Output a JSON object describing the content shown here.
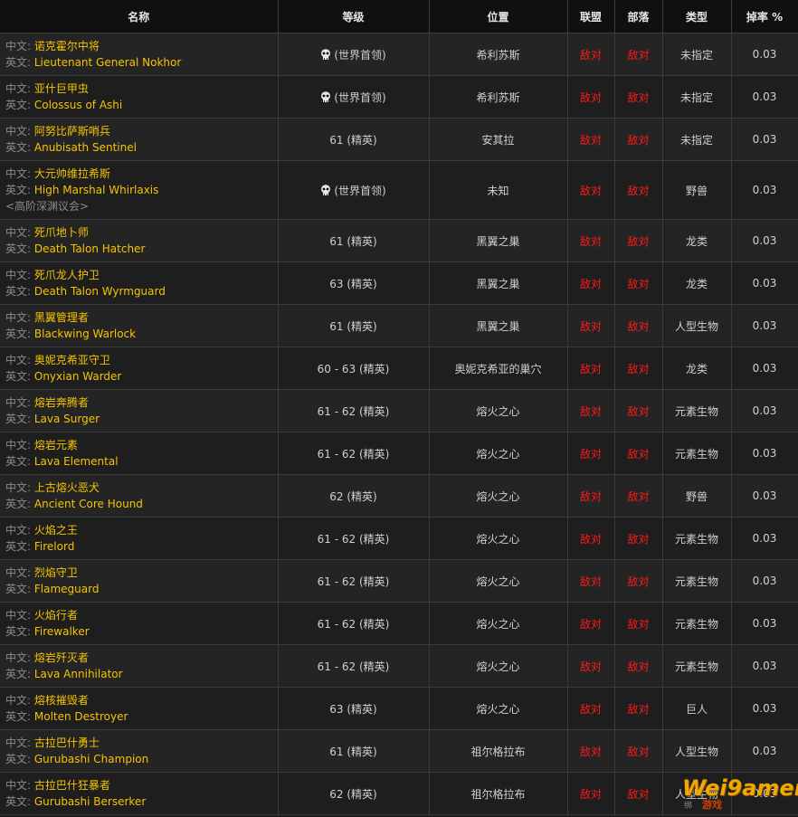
{
  "header": {
    "name": "名称",
    "level": "等级",
    "location": "位置",
    "alliance": "联盟",
    "horde": "部落",
    "type": "类型",
    "drop_rate": "掉率 %"
  },
  "labels": {
    "cn": "中文:",
    "en": "英文:"
  },
  "rows": [
    {
      "cn": "诺克霍尔中将",
      "en": "Lieutenant General Nokhor",
      "sub": "",
      "level": "(世界首领)",
      "skull": true,
      "location": "希利苏斯",
      "alliance": "敌对",
      "horde": "敌对",
      "type": "未指定",
      "rate": "0.03"
    },
    {
      "cn": "亚什巨甲虫",
      "en": "Colossus of Ashi",
      "sub": "",
      "level": "(世界首领)",
      "skull": true,
      "location": "希利苏斯",
      "alliance": "敌对",
      "horde": "敌对",
      "type": "未指定",
      "rate": "0.03"
    },
    {
      "cn": "阿努比萨斯哨兵",
      "en": "Anubisath Sentinel",
      "sub": "",
      "level": "61 (精英)",
      "skull": false,
      "location": "安其拉",
      "alliance": "敌对",
      "horde": "敌对",
      "type": "未指定",
      "rate": "0.03"
    },
    {
      "cn": "大元帅维拉希斯",
      "en": "High Marshal Whirlaxis",
      "sub": "<高阶深渊议会>",
      "level": "(世界首领)",
      "skull": true,
      "location": "未知",
      "alliance": "敌对",
      "horde": "敌对",
      "type": "野兽",
      "rate": "0.03"
    },
    {
      "cn": "死爪地卜师",
      "en": "Death Talon Hatcher",
      "sub": "",
      "level": "61 (精英)",
      "skull": false,
      "location": "黑翼之巢",
      "alliance": "敌对",
      "horde": "敌对",
      "type": "龙类",
      "rate": "0.03"
    },
    {
      "cn": "死爪龙人护卫",
      "en": "Death Talon Wyrmguard",
      "sub": "",
      "level": "63 (精英)",
      "skull": false,
      "location": "黑翼之巢",
      "alliance": "敌对",
      "horde": "敌对",
      "type": "龙类",
      "rate": "0.03"
    },
    {
      "cn": "黑翼管理者",
      "en": "Blackwing Warlock",
      "sub": "",
      "level": "61 (精英)",
      "skull": false,
      "location": "黑翼之巢",
      "alliance": "敌对",
      "horde": "敌对",
      "type": "人型生物",
      "rate": "0.03"
    },
    {
      "cn": "奥妮克希亚守卫",
      "en": "Onyxian Warder",
      "sub": "",
      "level": "60 - 63 (精英)",
      "skull": false,
      "location": "奥妮克希亚的巢穴",
      "alliance": "敌对",
      "horde": "敌对",
      "type": "龙类",
      "rate": "0.03"
    },
    {
      "cn": "熔岩奔腾者",
      "en": "Lava Surger",
      "sub": "",
      "level": "61 - 62 (精英)",
      "skull": false,
      "location": "熔火之心",
      "alliance": "敌对",
      "horde": "敌对",
      "type": "元素生物",
      "rate": "0.03"
    },
    {
      "cn": "熔岩元素",
      "en": "Lava Elemental",
      "sub": "",
      "level": "61 - 62 (精英)",
      "skull": false,
      "location": "熔火之心",
      "alliance": "敌对",
      "horde": "敌对",
      "type": "元素生物",
      "rate": "0.03"
    },
    {
      "cn": "上古熔火恶犬",
      "en": "Ancient Core Hound",
      "sub": "",
      "level": "62 (精英)",
      "skull": false,
      "location": "熔火之心",
      "alliance": "敌对",
      "horde": "敌对",
      "type": "野兽",
      "rate": "0.03"
    },
    {
      "cn": "火焰之王",
      "en": "Firelord",
      "sub": "",
      "level": "61 - 62 (精英)",
      "skull": false,
      "location": "熔火之心",
      "alliance": "敌对",
      "horde": "敌对",
      "type": "元素生物",
      "rate": "0.03"
    },
    {
      "cn": "烈焰守卫",
      "en": "Flameguard",
      "sub": "",
      "level": "61 - 62 (精英)",
      "skull": false,
      "location": "熔火之心",
      "alliance": "敌对",
      "horde": "敌对",
      "type": "元素生物",
      "rate": "0.03"
    },
    {
      "cn": "火焰行者",
      "en": "Firewalker",
      "sub": "",
      "level": "61 - 62 (精英)",
      "skull": false,
      "location": "熔火之心",
      "alliance": "敌对",
      "horde": "敌对",
      "type": "元素生物",
      "rate": "0.03"
    },
    {
      "cn": "熔岩歼灭者",
      "en": "Lava Annihilator",
      "sub": "",
      "level": "61 - 62 (精英)",
      "skull": false,
      "location": "熔火之心",
      "alliance": "敌对",
      "horde": "敌对",
      "type": "元素生物",
      "rate": "0.03"
    },
    {
      "cn": "熔核摧毁者",
      "en": "Molten Destroyer",
      "sub": "",
      "level": "63 (精英)",
      "skull": false,
      "location": "熔火之心",
      "alliance": "敌对",
      "horde": "敌对",
      "type": "巨人",
      "rate": "0.03"
    },
    {
      "cn": "古拉巴什勇士",
      "en": "Gurubashi Champion",
      "sub": "",
      "level": "61 (精英)",
      "skull": false,
      "location": "祖尔格拉布",
      "alliance": "敌对",
      "horde": "敌对",
      "type": "人型生物",
      "rate": "0.03"
    },
    {
      "cn": "古拉巴什狂暴者",
      "en": "Gurubashi Berserker",
      "sub": "",
      "level": "62 (精英)",
      "skull": false,
      "location": "祖尔格拉布",
      "alliance": "敌对",
      "horde": "敌对",
      "type": "人型生物",
      "rate": "0.03"
    }
  ],
  "watermark": {
    "main": "Wei9amer",
    "sub": "绑",
    "sub2": "游戏"
  },
  "colors": {
    "name": "#f5c400",
    "hostile": "#ff1a1a",
    "label": "#8a8a8a"
  }
}
